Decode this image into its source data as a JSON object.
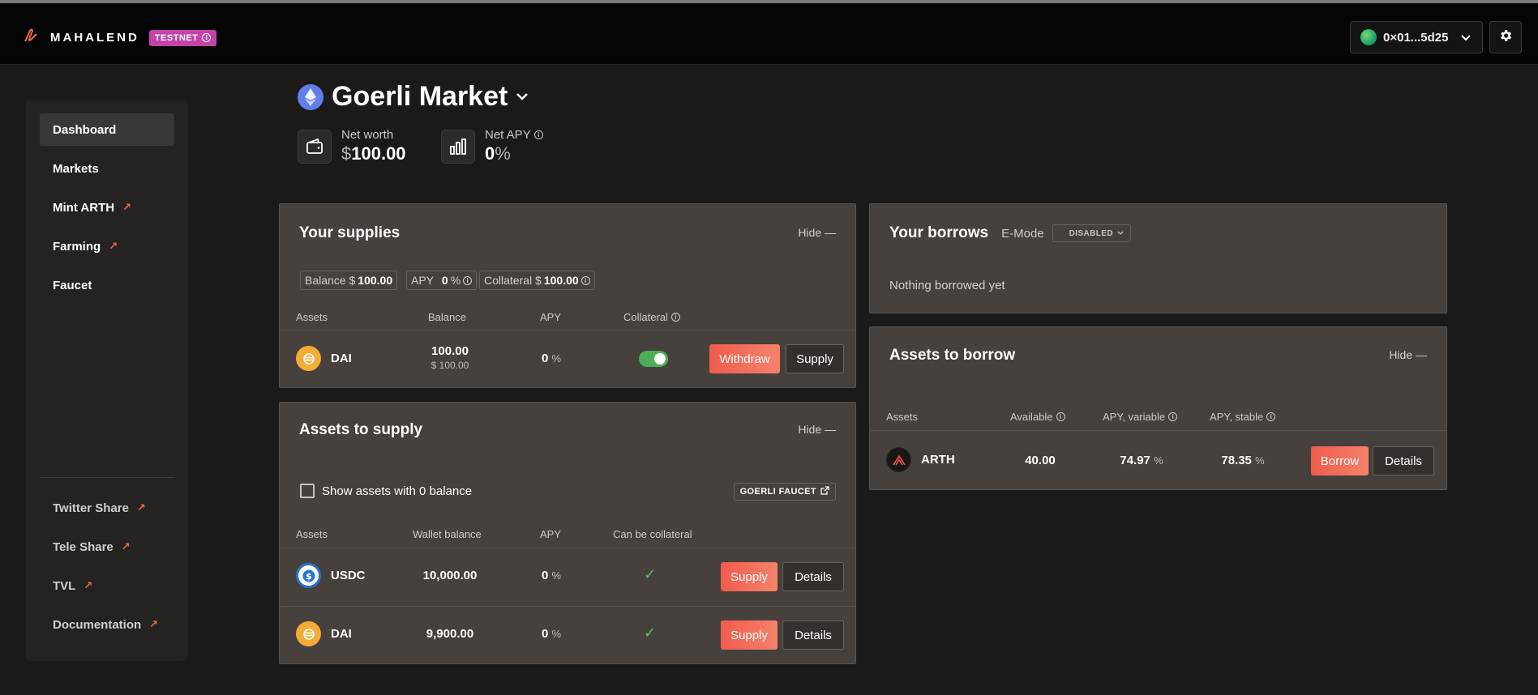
{
  "topbar": {
    "brand": "MAHALEND",
    "testnet_badge": "TESTNET",
    "wallet_address": "0×01...5d25"
  },
  "sidebar": {
    "items": [
      {
        "label": "Dashboard",
        "active": true
      },
      {
        "label": "Markets"
      },
      {
        "label": "Mint ARTH",
        "external": true
      },
      {
        "label": "Farming",
        "external": true
      },
      {
        "label": "Faucet"
      }
    ],
    "footer_items": [
      {
        "label": "Twitter Share",
        "external": true
      },
      {
        "label": "Tele Share",
        "external": true
      },
      {
        "label": "TVL",
        "external": true
      },
      {
        "label": "Documentation",
        "external": true
      }
    ]
  },
  "market": {
    "title": "Goerli Market",
    "net_worth_label": "Net worth",
    "net_worth_currency": "$",
    "net_worth_value": "100.00",
    "net_apy_label": "Net APY",
    "net_apy_value": "0",
    "net_apy_unit": "%"
  },
  "supplies": {
    "title": "Your supplies",
    "hide_label": "Hide —",
    "balance_label": "Balance $",
    "balance_value": "100.00",
    "apy_label": "APY",
    "apy_value": "0",
    "apy_unit": "%",
    "collateral_label": "Collateral $",
    "collateral_value": "100.00",
    "columns": [
      "Assets",
      "Balance",
      "APY",
      "Collateral"
    ],
    "rows": [
      {
        "asset": "DAI",
        "balance": "100.00",
        "balance_usd": "$ 100.00",
        "apy": "0",
        "collateral_enabled": true,
        "primary_action": "Withdraw",
        "secondary_action": "Supply"
      }
    ]
  },
  "assets_to_supply": {
    "title": "Assets to supply",
    "hide_label": "Hide —",
    "show_zero_label": "Show assets with 0 balance",
    "faucet_label": "GOERLI FAUCET",
    "columns": [
      "Assets",
      "Wallet balance",
      "APY",
      "Can be collateral"
    ],
    "rows": [
      {
        "asset": "USDC",
        "wallet_balance": "10,000.00",
        "apy": "0",
        "can_be_collateral": true,
        "primary_action": "Supply",
        "secondary_action": "Details"
      },
      {
        "asset": "DAI",
        "wallet_balance": "9,900.00",
        "apy": "0",
        "can_be_collateral": true,
        "primary_action": "Supply",
        "secondary_action": "Details"
      }
    ]
  },
  "borrows": {
    "title": "Your borrows",
    "emode_label": "E-Mode",
    "emode_value": "DISABLED",
    "empty_text": "Nothing borrowed yet"
  },
  "assets_to_borrow": {
    "title": "Assets to borrow",
    "hide_label": "Hide —",
    "columns": [
      "Assets",
      "Available",
      "APY, variable",
      "APY, stable"
    ],
    "rows": [
      {
        "asset": "ARTH",
        "available": "40.00",
        "apy_variable": "74.97",
        "apy_stable": "78.35",
        "primary_action": "Borrow",
        "secondary_action": "Details"
      }
    ]
  },
  "colors": {
    "accent": "#f05c4c",
    "testnet": "#c244a8",
    "panel": "#47413d",
    "success": "#5bc065"
  },
  "icons": [
    "mahalend-logo-icon",
    "info-icon",
    "chevron-down-icon",
    "gear-icon",
    "ethereum-icon",
    "wallet-icon",
    "chart-bars-icon",
    "external-arrow-icon",
    "dai-coin-icon",
    "usdc-coin-icon",
    "arth-coin-icon",
    "checkmark-icon",
    "external-link-icon"
  ]
}
